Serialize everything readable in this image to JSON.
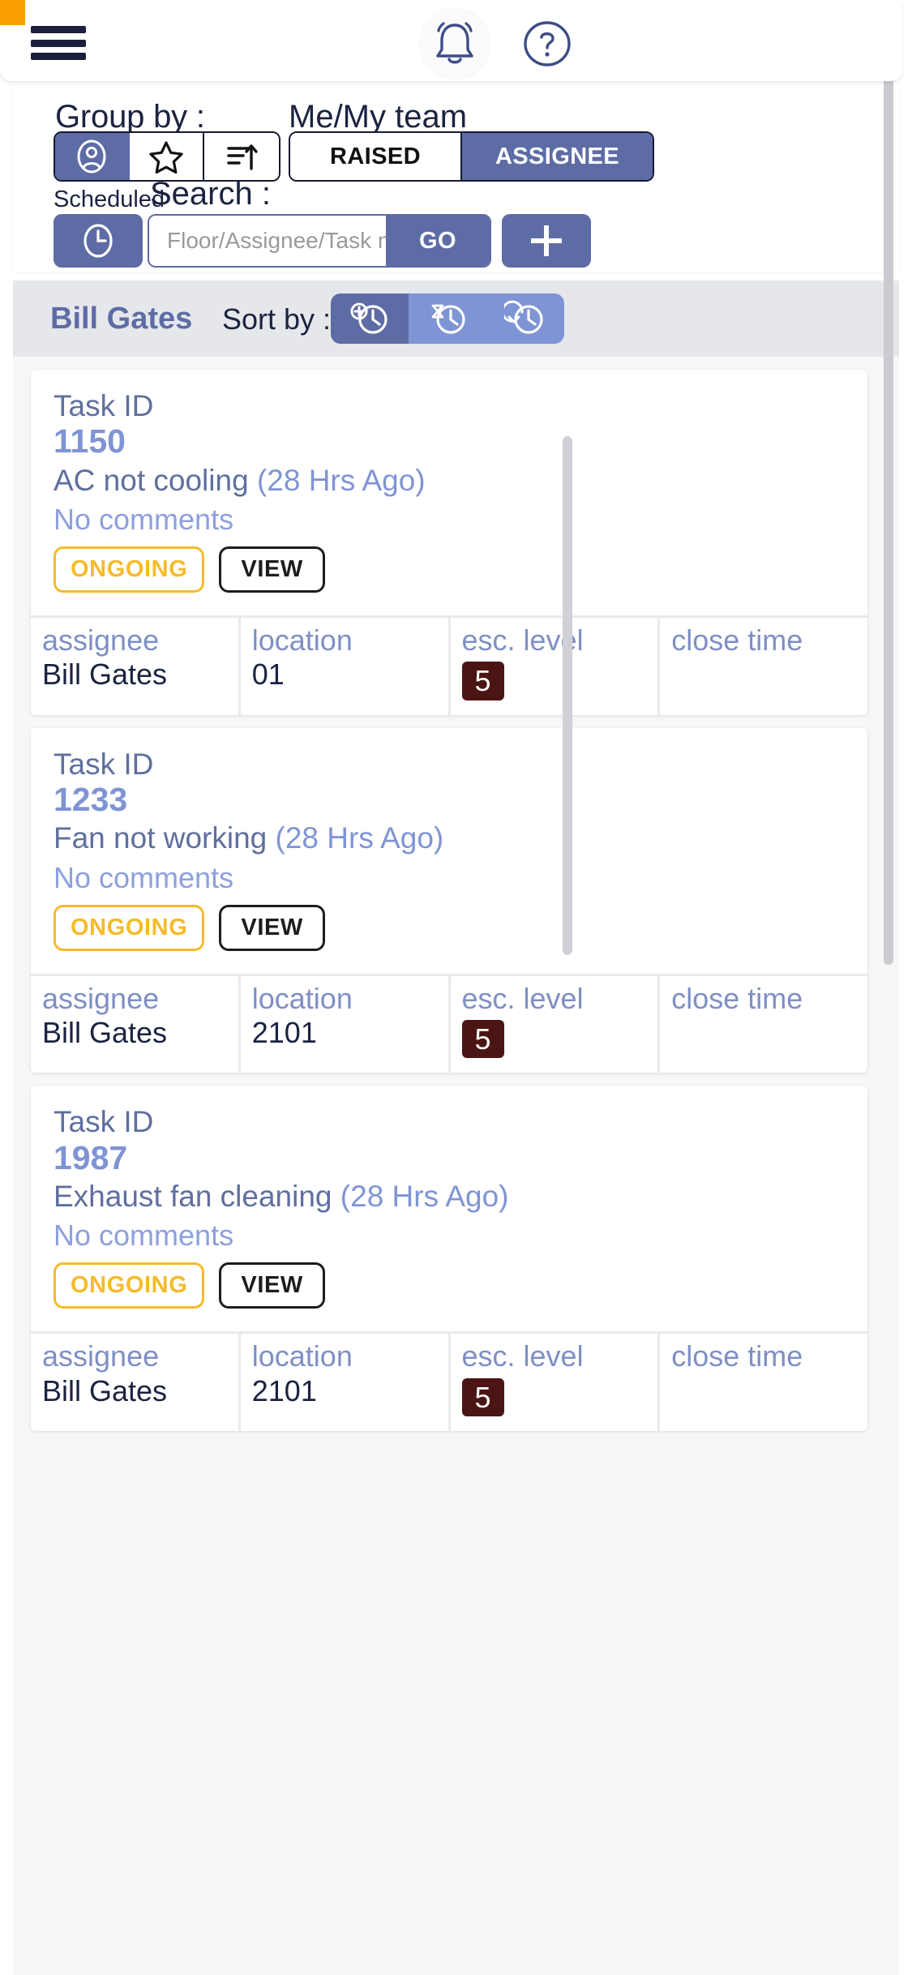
{
  "appbar": {
    "menu_icon": "hamburger-menu-icon",
    "notification_icon": "bell-icon",
    "help_icon": "question-mark-icon"
  },
  "filters": {
    "group_by_label": "Group by :",
    "me_my_team_label": "Me/My team",
    "scheduled_label": "Scheduled",
    "search_label": "Search :",
    "group_by_options": [
      {
        "icon": "person-circle-icon",
        "name": "group-by-assignee",
        "active": true
      },
      {
        "icon": "star-icon",
        "name": "group-by-priority",
        "active": false
      },
      {
        "icon": "sort-lines-up-arrow-icon",
        "name": "group-by-sort",
        "active": false
      }
    ],
    "me_my_team_options": [
      {
        "label": "RAISED",
        "active": false
      },
      {
        "label": "ASSIGNEE",
        "active": true
      }
    ],
    "scheduled_icon": "clock-icon",
    "search_placeholder": "Floor/Assignee/Task name",
    "search_value": "",
    "go_label": "GO",
    "add_icon": "plus-icon"
  },
  "sort": {
    "group_name": "Bill Gates",
    "sort_by_label": "Sort by :",
    "options": [
      {
        "icon": "clock-plus-icon",
        "name": "sort-by-created",
        "active": true
      },
      {
        "icon": "clock-hourglass-icon",
        "name": "sort-by-pending",
        "active": false
      },
      {
        "icon": "clock-refresh-icon",
        "name": "sort-by-updated",
        "active": false
      }
    ]
  },
  "table_headers": {
    "assignee": "assignee",
    "location": "location",
    "esc_level": "esc. level",
    "close_time": "close time"
  },
  "tasks": [
    {
      "id_label": "Task ID",
      "id": "1150",
      "title": "AC not cooling",
      "age": "(28 Hrs Ago)",
      "comments": "No comments",
      "status": "ONGOING",
      "view_label": "VIEW",
      "assignee": "Bill Gates",
      "location": "01",
      "esc_level": "5",
      "close_time": ""
    },
    {
      "id_label": "Task ID",
      "id": "1233",
      "title": "Fan not working",
      "age": "(28 Hrs Ago)",
      "comments": "No comments",
      "status": "ONGOING",
      "view_label": "VIEW",
      "assignee": "Bill Gates",
      "location": "2101",
      "esc_level": "5",
      "close_time": ""
    },
    {
      "id_label": "Task ID",
      "id": "1987",
      "title": "Exhaust fan cleaning",
      "age": "(28 Hrs Ago)",
      "comments": "No comments",
      "status": "ONGOING",
      "view_label": "VIEW",
      "assignee": "Bill Gates",
      "location": "2101",
      "esc_level": "5",
      "close_time": ""
    }
  ],
  "colors": {
    "accent": "#5e6ca5",
    "accent_light": "#7f94d4",
    "status_ongoing": "#f5bb2a",
    "esc_chip": "#4a1513",
    "header_grey": "#e5e7eb",
    "corner_marker": "#f9a000"
  }
}
